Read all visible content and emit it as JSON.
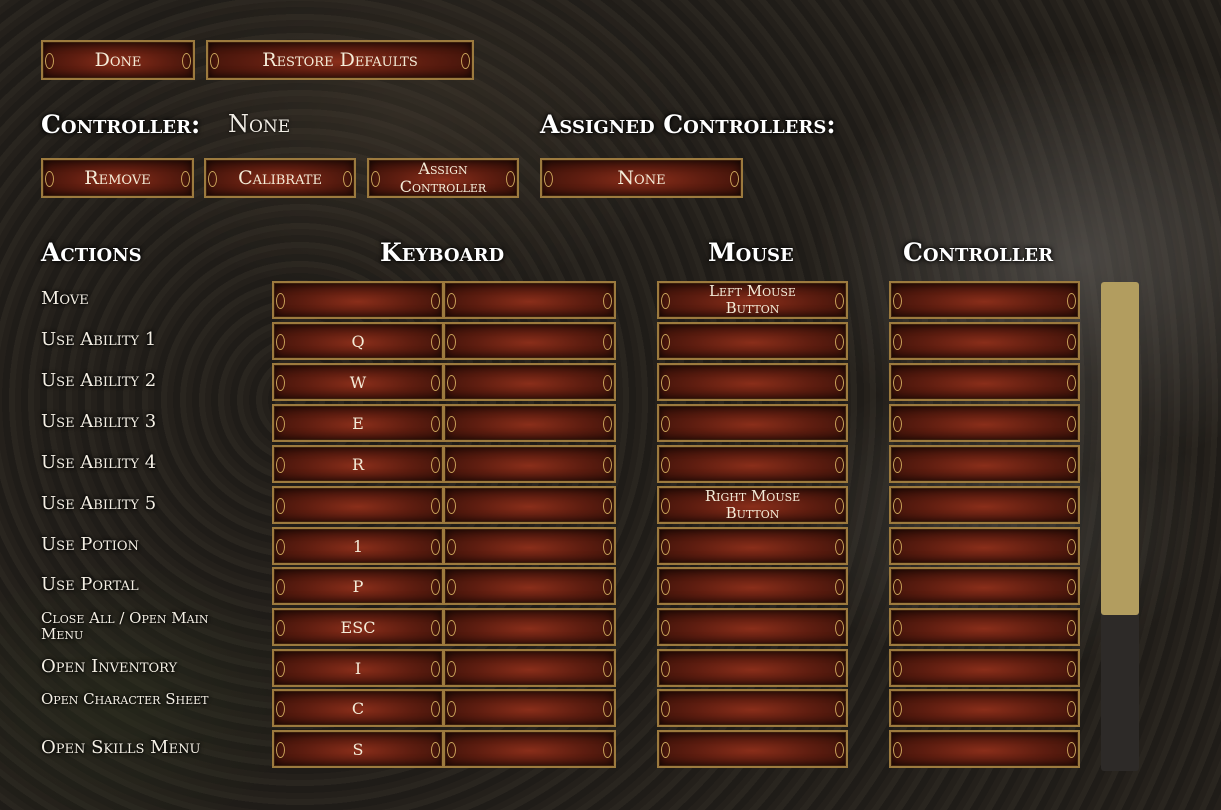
{
  "top_buttons": {
    "done": "Done",
    "restore_defaults": "Restore Defaults"
  },
  "controller": {
    "label": "Controller:",
    "value": "None",
    "assigned_label": "Assigned Controllers:",
    "remove": "Remove",
    "calibrate": "Calibrate",
    "assign_line1": "Assign",
    "assign_line2": "Controller",
    "assigned_value": "None"
  },
  "columns": {
    "actions": "Actions",
    "keyboard": "Keyboard",
    "mouse": "Mouse",
    "controller": "Controller"
  },
  "rows": [
    {
      "action": "Move",
      "key1": "",
      "key2": "",
      "mouse": "Left Mouse Button",
      "controller": ""
    },
    {
      "action": "Use Ability 1",
      "key1": "Q",
      "key2": "",
      "mouse": "",
      "controller": ""
    },
    {
      "action": "Use Ability 2",
      "key1": "W",
      "key2": "",
      "mouse": "",
      "controller": ""
    },
    {
      "action": "Use Ability 3",
      "key1": "E",
      "key2": "",
      "mouse": "",
      "controller": ""
    },
    {
      "action": "Use Ability 4",
      "key1": "R",
      "key2": "",
      "mouse": "",
      "controller": ""
    },
    {
      "action": "Use Ability 5",
      "key1": "",
      "key2": "",
      "mouse": "Right Mouse Button",
      "controller": ""
    },
    {
      "action": "Use Potion",
      "key1": "1",
      "key2": "",
      "mouse": "",
      "controller": ""
    },
    {
      "action": "Use Portal",
      "key1": "P",
      "key2": "",
      "mouse": "",
      "controller": ""
    },
    {
      "action": "Close All / Open Main Menu",
      "key1": "ESC",
      "key2": "",
      "mouse": "",
      "controller": ""
    },
    {
      "action": "Open Inventory",
      "key1": "I",
      "key2": "",
      "mouse": "",
      "controller": ""
    },
    {
      "action": "Open Character Sheet",
      "key1": "C",
      "key2": "",
      "mouse": "",
      "controller": ""
    },
    {
      "action": "Open Skills Menu",
      "key1": "S",
      "key2": "",
      "mouse": "",
      "controller": ""
    }
  ],
  "scrollbar": {
    "thumb_fraction": 0.68
  },
  "colors": {
    "accent_gold": "#9c7a3e",
    "button_red": "#8a2e1a",
    "scroll_thumb": "#b29d5f"
  }
}
